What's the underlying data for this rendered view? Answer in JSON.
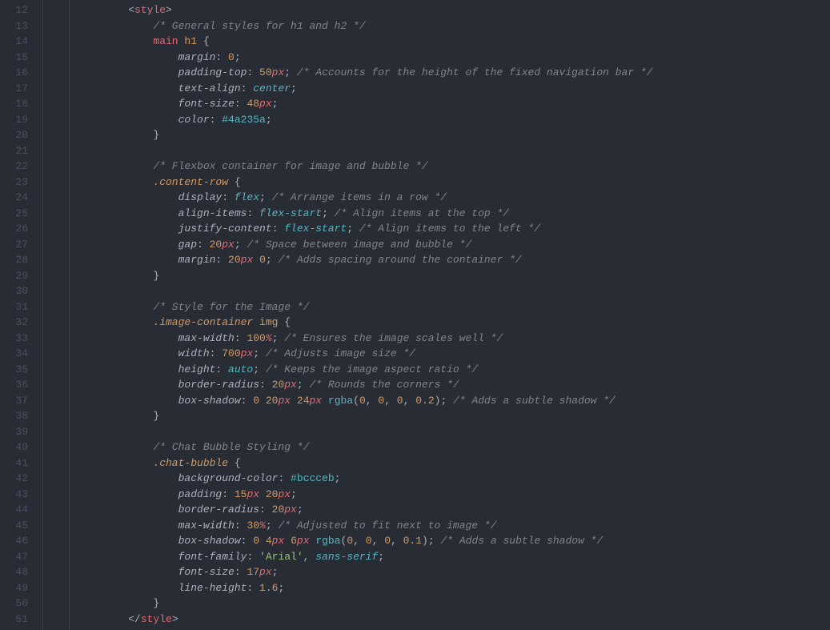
{
  "lineStart": 12,
  "lineEnd": 51,
  "lines": [
    {
      "n": 12,
      "indent": 1,
      "tokens": [
        {
          "t": "angle",
          "v": "<"
        },
        {
          "t": "tag",
          "v": "style"
        },
        {
          "t": "angle",
          "v": ">"
        }
      ]
    },
    {
      "n": 13,
      "indent": 2,
      "tokens": [
        {
          "t": "comment",
          "v": "/* General styles for h1 and h2 */"
        }
      ]
    },
    {
      "n": 14,
      "indent": 2,
      "tokens": [
        {
          "t": "tag",
          "v": "main "
        },
        {
          "t": "selector",
          "v": "h1"
        },
        {
          "t": "punct",
          "v": " "
        },
        {
          "t": "brace",
          "v": "{"
        }
      ]
    },
    {
      "n": 15,
      "indent": 3,
      "tokens": [
        {
          "t": "prop",
          "v": "margin"
        },
        {
          "t": "punct",
          "v": ": "
        },
        {
          "t": "value-num",
          "v": "0"
        },
        {
          "t": "punct",
          "v": ";"
        }
      ]
    },
    {
      "n": 16,
      "indent": 3,
      "tokens": [
        {
          "t": "prop",
          "v": "padding-top"
        },
        {
          "t": "punct",
          "v": ": "
        },
        {
          "t": "value-num",
          "v": "50"
        },
        {
          "t": "value-unit",
          "v": "px"
        },
        {
          "t": "punct",
          "v": "; "
        },
        {
          "t": "comment",
          "v": "/* Accounts for the height of the fixed navigation bar */"
        }
      ]
    },
    {
      "n": 17,
      "indent": 3,
      "tokens": [
        {
          "t": "prop",
          "v": "text-align"
        },
        {
          "t": "punct",
          "v": ": "
        },
        {
          "t": "value-kw",
          "v": "center"
        },
        {
          "t": "punct",
          "v": ";"
        }
      ]
    },
    {
      "n": 18,
      "indent": 3,
      "tokens": [
        {
          "t": "prop",
          "v": "font-size"
        },
        {
          "t": "punct",
          "v": ": "
        },
        {
          "t": "value-num",
          "v": "48"
        },
        {
          "t": "value-unit",
          "v": "px"
        },
        {
          "t": "punct",
          "v": ";"
        }
      ]
    },
    {
      "n": 19,
      "indent": 3,
      "tokens": [
        {
          "t": "prop",
          "v": "color"
        },
        {
          "t": "punct",
          "v": ": "
        },
        {
          "t": "value-col",
          "v": "#4a235a"
        },
        {
          "t": "punct",
          "v": ";"
        }
      ]
    },
    {
      "n": 20,
      "indent": 2,
      "tokens": [
        {
          "t": "brace",
          "v": "}"
        }
      ]
    },
    {
      "n": 21,
      "indent": 0,
      "tokens": []
    },
    {
      "n": 22,
      "indent": 2,
      "tokens": [
        {
          "t": "comment",
          "v": "/* Flexbox container for image and bubble */"
        }
      ]
    },
    {
      "n": 23,
      "indent": 2,
      "tokens": [
        {
          "t": "selector selclass",
          "v": ".content-row"
        },
        {
          "t": "punct",
          "v": " "
        },
        {
          "t": "brace",
          "v": "{"
        }
      ]
    },
    {
      "n": 24,
      "indent": 3,
      "tokens": [
        {
          "t": "prop",
          "v": "display"
        },
        {
          "t": "punct",
          "v": ": "
        },
        {
          "t": "value-kw",
          "v": "flex"
        },
        {
          "t": "punct",
          "v": "; "
        },
        {
          "t": "comment",
          "v": "/* Arrange items in a row */"
        }
      ]
    },
    {
      "n": 25,
      "indent": 3,
      "tokens": [
        {
          "t": "prop",
          "v": "align-items"
        },
        {
          "t": "punct",
          "v": ": "
        },
        {
          "t": "value-kw",
          "v": "flex-start"
        },
        {
          "t": "punct",
          "v": "; "
        },
        {
          "t": "comment",
          "v": "/* Align items at the top */"
        }
      ]
    },
    {
      "n": 26,
      "indent": 3,
      "tokens": [
        {
          "t": "prop",
          "v": "justify-content"
        },
        {
          "t": "punct",
          "v": ": "
        },
        {
          "t": "value-kw",
          "v": "flex-start"
        },
        {
          "t": "punct",
          "v": "; "
        },
        {
          "t": "comment",
          "v": "/* Align items to the left */"
        }
      ]
    },
    {
      "n": 27,
      "indent": 3,
      "tokens": [
        {
          "t": "prop",
          "v": "gap"
        },
        {
          "t": "punct",
          "v": ": "
        },
        {
          "t": "value-num",
          "v": "20"
        },
        {
          "t": "value-unit",
          "v": "px"
        },
        {
          "t": "punct",
          "v": "; "
        },
        {
          "t": "comment",
          "v": "/* Space between image and bubble */"
        }
      ]
    },
    {
      "n": 28,
      "indent": 3,
      "tokens": [
        {
          "t": "prop",
          "v": "margin"
        },
        {
          "t": "punct",
          "v": ": "
        },
        {
          "t": "value-num",
          "v": "20"
        },
        {
          "t": "value-unit",
          "v": "px"
        },
        {
          "t": "punct",
          "v": " "
        },
        {
          "t": "value-num",
          "v": "0"
        },
        {
          "t": "punct",
          "v": "; "
        },
        {
          "t": "comment",
          "v": "/* Adds spacing around the container */"
        }
      ]
    },
    {
      "n": 29,
      "indent": 2,
      "tokens": [
        {
          "t": "brace",
          "v": "}"
        }
      ]
    },
    {
      "n": 30,
      "indent": 0,
      "tokens": []
    },
    {
      "n": 31,
      "indent": 2,
      "tokens": [
        {
          "t": "comment",
          "v": "/* Style for the Image */"
        }
      ]
    },
    {
      "n": 32,
      "indent": 2,
      "tokens": [
        {
          "t": "selector selclass",
          "v": ".image-container"
        },
        {
          "t": "punct",
          "v": " "
        },
        {
          "t": "selector",
          "v": "img"
        },
        {
          "t": "punct",
          "v": " "
        },
        {
          "t": "brace",
          "v": "{"
        }
      ]
    },
    {
      "n": 33,
      "indent": 3,
      "tokens": [
        {
          "t": "prop",
          "v": "max-width"
        },
        {
          "t": "punct",
          "v": ": "
        },
        {
          "t": "value-num",
          "v": "100"
        },
        {
          "t": "value-unit",
          "v": "%"
        },
        {
          "t": "punct",
          "v": "; "
        },
        {
          "t": "comment",
          "v": "/* Ensures the image scales well */"
        }
      ]
    },
    {
      "n": 34,
      "indent": 3,
      "tokens": [
        {
          "t": "prop",
          "v": "width"
        },
        {
          "t": "punct",
          "v": ": "
        },
        {
          "t": "value-num",
          "v": "700"
        },
        {
          "t": "value-unit",
          "v": "px"
        },
        {
          "t": "punct",
          "v": "; "
        },
        {
          "t": "comment",
          "v": "/* Adjusts image size */"
        }
      ]
    },
    {
      "n": 35,
      "indent": 3,
      "tokens": [
        {
          "t": "prop",
          "v": "height"
        },
        {
          "t": "punct",
          "v": ": "
        },
        {
          "t": "value-kw",
          "v": "auto"
        },
        {
          "t": "punct",
          "v": "; "
        },
        {
          "t": "comment",
          "v": "/* Keeps the image aspect ratio */"
        }
      ]
    },
    {
      "n": 36,
      "indent": 3,
      "tokens": [
        {
          "t": "prop",
          "v": "border-radius"
        },
        {
          "t": "punct",
          "v": ": "
        },
        {
          "t": "value-num",
          "v": "20"
        },
        {
          "t": "value-unit",
          "v": "px"
        },
        {
          "t": "punct",
          "v": "; "
        },
        {
          "t": "comment",
          "v": "/* Rounds the corners */"
        }
      ]
    },
    {
      "n": 37,
      "indent": 3,
      "tokens": [
        {
          "t": "prop",
          "v": "box-shadow"
        },
        {
          "t": "punct",
          "v": ": "
        },
        {
          "t": "value-num",
          "v": "0"
        },
        {
          "t": "punct",
          "v": " "
        },
        {
          "t": "value-num",
          "v": "20"
        },
        {
          "t": "value-unit",
          "v": "px"
        },
        {
          "t": "punct",
          "v": " "
        },
        {
          "t": "value-num",
          "v": "24"
        },
        {
          "t": "value-unit",
          "v": "px"
        },
        {
          "t": "punct",
          "v": " "
        },
        {
          "t": "value-fn",
          "v": "rgba"
        },
        {
          "t": "punct",
          "v": "("
        },
        {
          "t": "value-num",
          "v": "0"
        },
        {
          "t": "punct",
          "v": ", "
        },
        {
          "t": "value-num",
          "v": "0"
        },
        {
          "t": "punct",
          "v": ", "
        },
        {
          "t": "value-num",
          "v": "0"
        },
        {
          "t": "punct",
          "v": ", "
        },
        {
          "t": "value-num",
          "v": "0.2"
        },
        {
          "t": "punct",
          "v": ")"
        },
        {
          "t": "punct",
          "v": "; "
        },
        {
          "t": "comment",
          "v": "/* Adds a subtle shadow */"
        }
      ]
    },
    {
      "n": 38,
      "indent": 2,
      "tokens": [
        {
          "t": "brace",
          "v": "}"
        }
      ]
    },
    {
      "n": 39,
      "indent": 0,
      "tokens": []
    },
    {
      "n": 40,
      "indent": 2,
      "tokens": [
        {
          "t": "comment",
          "v": "/* Chat Bubble Styling */"
        }
      ]
    },
    {
      "n": 41,
      "indent": 2,
      "tokens": [
        {
          "t": "selector selclass",
          "v": ".chat-bubble"
        },
        {
          "t": "punct",
          "v": " "
        },
        {
          "t": "brace",
          "v": "{"
        }
      ]
    },
    {
      "n": 42,
      "indent": 3,
      "tokens": [
        {
          "t": "prop",
          "v": "background-color"
        },
        {
          "t": "punct",
          "v": ": "
        },
        {
          "t": "value-col",
          "v": "#bccceb"
        },
        {
          "t": "punct",
          "v": ";"
        }
      ]
    },
    {
      "n": 43,
      "indent": 3,
      "tokens": [
        {
          "t": "prop",
          "v": "padding"
        },
        {
          "t": "punct",
          "v": ": "
        },
        {
          "t": "value-num",
          "v": "15"
        },
        {
          "t": "value-unit",
          "v": "px"
        },
        {
          "t": "punct",
          "v": " "
        },
        {
          "t": "value-num",
          "v": "20"
        },
        {
          "t": "value-unit",
          "v": "px"
        },
        {
          "t": "punct",
          "v": ";"
        }
      ]
    },
    {
      "n": 44,
      "indent": 3,
      "tokens": [
        {
          "t": "prop",
          "v": "border-radius"
        },
        {
          "t": "punct",
          "v": ": "
        },
        {
          "t": "value-num",
          "v": "20"
        },
        {
          "t": "value-unit",
          "v": "px"
        },
        {
          "t": "punct",
          "v": ";"
        }
      ]
    },
    {
      "n": 45,
      "indent": 3,
      "tokens": [
        {
          "t": "prop",
          "v": "max-width"
        },
        {
          "t": "punct",
          "v": ": "
        },
        {
          "t": "value-num",
          "v": "30"
        },
        {
          "t": "value-unit",
          "v": "%"
        },
        {
          "t": "punct",
          "v": "; "
        },
        {
          "t": "comment",
          "v": "/* Adjusted to fit next to image */"
        }
      ]
    },
    {
      "n": 46,
      "indent": 3,
      "tokens": [
        {
          "t": "prop",
          "v": "box-shadow"
        },
        {
          "t": "punct",
          "v": ": "
        },
        {
          "t": "value-num",
          "v": "0"
        },
        {
          "t": "punct",
          "v": " "
        },
        {
          "t": "value-num",
          "v": "4"
        },
        {
          "t": "value-unit",
          "v": "px"
        },
        {
          "t": "punct",
          "v": " "
        },
        {
          "t": "value-num",
          "v": "6"
        },
        {
          "t": "value-unit",
          "v": "px"
        },
        {
          "t": "punct",
          "v": " "
        },
        {
          "t": "value-fn",
          "v": "rgba"
        },
        {
          "t": "punct",
          "v": "("
        },
        {
          "t": "value-num",
          "v": "0"
        },
        {
          "t": "punct",
          "v": ", "
        },
        {
          "t": "value-num",
          "v": "0"
        },
        {
          "t": "punct",
          "v": ", "
        },
        {
          "t": "value-num",
          "v": "0"
        },
        {
          "t": "punct",
          "v": ", "
        },
        {
          "t": "value-num",
          "v": "0.1"
        },
        {
          "t": "punct",
          "v": ")"
        },
        {
          "t": "punct",
          "v": "; "
        },
        {
          "t": "comment",
          "v": "/* Adds a subtle shadow */"
        }
      ]
    },
    {
      "n": 47,
      "indent": 3,
      "tokens": [
        {
          "t": "prop",
          "v": "font-family"
        },
        {
          "t": "punct",
          "v": ": "
        },
        {
          "t": "value-str",
          "v": "'Arial'"
        },
        {
          "t": "punct",
          "v": ", "
        },
        {
          "t": "value-kw",
          "v": "sans-serif"
        },
        {
          "t": "punct",
          "v": ";"
        }
      ]
    },
    {
      "n": 48,
      "indent": 3,
      "tokens": [
        {
          "t": "prop",
          "v": "font-size"
        },
        {
          "t": "punct",
          "v": ": "
        },
        {
          "t": "value-num",
          "v": "17"
        },
        {
          "t": "value-unit",
          "v": "px"
        },
        {
          "t": "punct",
          "v": ";"
        }
      ]
    },
    {
      "n": 49,
      "indent": 3,
      "tokens": [
        {
          "t": "prop",
          "v": "line-height"
        },
        {
          "t": "punct",
          "v": ": "
        },
        {
          "t": "value-num",
          "v": "1.6"
        },
        {
          "t": "punct",
          "v": ";"
        }
      ]
    },
    {
      "n": 50,
      "indent": 2,
      "tokens": [
        {
          "t": "brace",
          "v": "}"
        }
      ]
    },
    {
      "n": 51,
      "indent": 1,
      "tokens": [
        {
          "t": "angle",
          "v": "</"
        },
        {
          "t": "tag",
          "v": "style"
        },
        {
          "t": "angle",
          "v": ">"
        }
      ]
    }
  ]
}
